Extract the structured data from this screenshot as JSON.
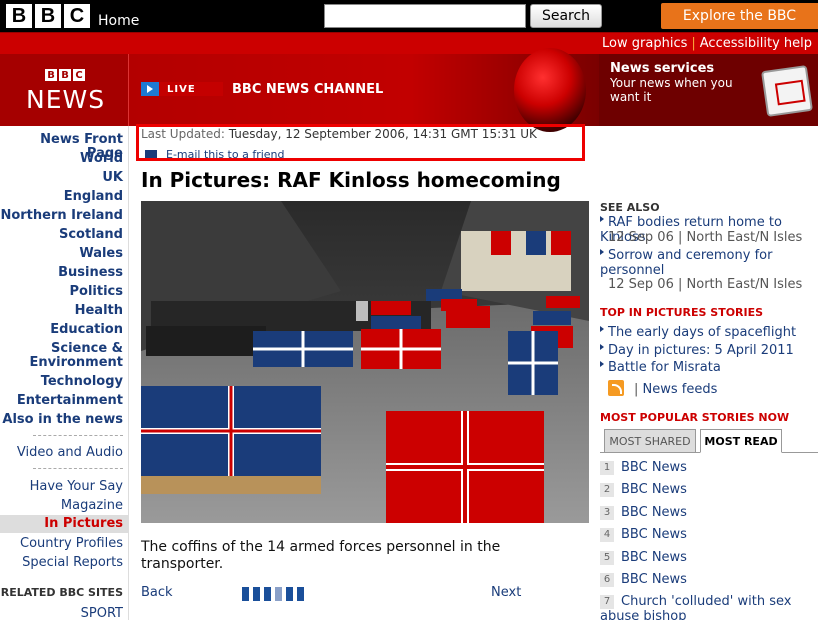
{
  "topbar": {
    "logo_letters": [
      "B",
      "B",
      "C"
    ],
    "home_label": "Home",
    "search_placeholder": "",
    "search_button": "Search",
    "explore_button": "Explore the BBC"
  },
  "redbar": {
    "low_graphics": "Low graphics",
    "separator": "|",
    "accessibility": "Accessibility help"
  },
  "banner": {
    "logo_mini": [
      "B",
      "B",
      "C"
    ],
    "logo_word": "NEWS",
    "live_label": "LIVE",
    "channel_title": "BBC NEWS CHANNEL",
    "news_services_title": "News services",
    "news_services_text": "Your news when you want it"
  },
  "leftnav": {
    "items": [
      "News Front Page",
      "World",
      "UK",
      "England",
      "Northern Ireland",
      "Scotland",
      "Wales",
      "Business",
      "Politics",
      "Health",
      "Education",
      "Science &",
      "Environment",
      "Technology",
      "Entertainment",
      "Also in the news"
    ],
    "secondary": [
      "Video and Audio"
    ],
    "tertiary": [
      "Have Your Say",
      "Magazine",
      "In Pictures",
      "Country Profiles",
      "Special Reports"
    ],
    "related_heading": "RELATED BBC SITES",
    "related": [
      "SPORT"
    ]
  },
  "article": {
    "updated_label": "Last Updated:",
    "updated_value": "Tuesday, 12 September 2006, 14:31 GMT 15:31 UK",
    "email_link": "E-mail this to a friend",
    "headline": "In Pictures: RAF Kinloss homecoming",
    "caption": "The coffins of the 14 armed forces personnel in the transporter.",
    "back": "Back",
    "next": "Next",
    "pager_count": 6,
    "pager_current": 4
  },
  "right": {
    "see_also_heading": "SEE ALSO",
    "see_also": [
      {
        "title": "RAF bodies return home to Kinloss",
        "date": "12 Sep 06",
        "section": "North East/N Isles"
      },
      {
        "title": "Sorrow and ceremony for personnel",
        "date": "12 Sep 06",
        "section": "North East/N Isles"
      }
    ],
    "meta_sep": "|",
    "top_heading": "TOP IN PICTURES STORIES",
    "top_stories": [
      "The early days of spaceflight",
      "Day in pictures: 5 April 2011",
      "Battle for Misrata"
    ],
    "feeds_sep": "|",
    "news_feeds": "News feeds",
    "popular_heading": "MOST POPULAR STORIES NOW",
    "tab_shared": "MOST SHARED",
    "tab_read": "MOST READ",
    "most_read": [
      {
        "n": "1",
        "title": "BBC News"
      },
      {
        "n": "2",
        "title": "BBC News"
      },
      {
        "n": "3",
        "title": "BBC News"
      },
      {
        "n": "4",
        "title": "BBC News"
      },
      {
        "n": "5",
        "title": "BBC News"
      },
      {
        "n": "6",
        "title": "BBC News"
      },
      {
        "n": "7",
        "title": "Church 'colluded' with sex abuse bishop"
      }
    ]
  }
}
